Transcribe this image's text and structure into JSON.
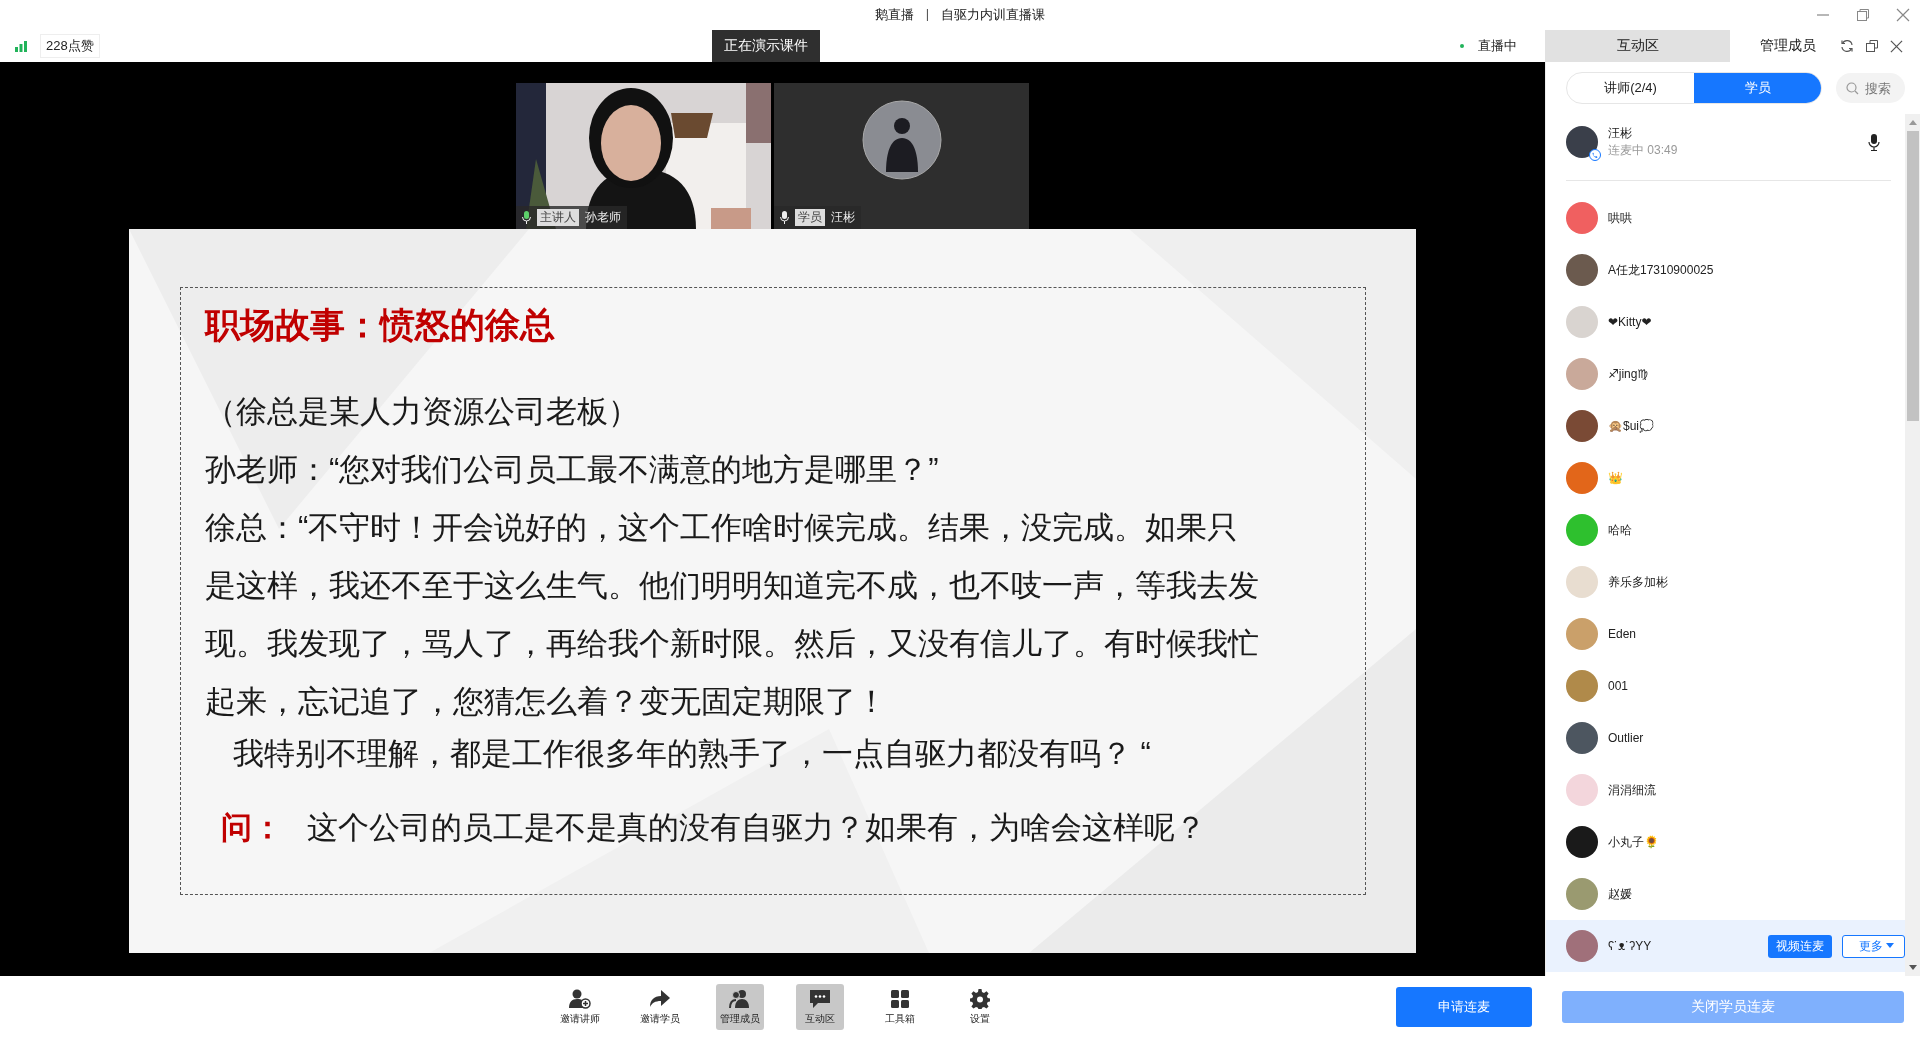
{
  "window": {
    "app": "鹅直播",
    "separator": "|",
    "title": "自驱力内训直播课"
  },
  "header": {
    "likes": "228点赞",
    "presenting": "正在演示课件",
    "live_status": "直播中",
    "tabs": [
      {
        "label": "互动区",
        "selected": true
      },
      {
        "label": "管理成员",
        "selected": false
      }
    ]
  },
  "videos": [
    {
      "kind": "picture",
      "role": "主讲人",
      "name": "孙老师"
    },
    {
      "kind": "avatar",
      "role": "学员",
      "name": "汪彬"
    }
  ],
  "slide": {
    "title": "职场故事：愤怒的徐总",
    "intro": "（徐总是某人力资源公司老板）",
    "question_line": "孙老师：“您对我们公司员工最不满意的地方是哪里？”",
    "answer_lines": [
      "徐总：“不守时！开会说好的，这个工作啥时候完成。结果，没完成。如果只",
      "是这样，我还不至于这么生气。他们明明知道完不成，也不吱一声，等我去发",
      "现。我发现了，骂人了，再给我个新时限。然后，又没有信儿了。有时候我忙",
      "起来，忘记追了，您猜怎么着？变无固定期限了！"
    ],
    "closing": "我特别不理解，都是工作很多年的熟手了，一点自驱力都没有吗？ “",
    "ask_label": "问：",
    "ask": "这个公司的员工是不是真的没有自驱力？如果有，为啥会这样呢？"
  },
  "panel": {
    "tabs": [
      {
        "label": "讲师(2/4)",
        "selected": false
      },
      {
        "label": "学员",
        "selected": true
      }
    ],
    "search": {
      "placeholder": "搜索"
    },
    "connected": {
      "name": "汪彬",
      "status": "连麦中 03:49",
      "color": "#3a3f4a"
    },
    "row_actions": [
      "视频连麦",
      "更多"
    ],
    "members": [
      {
        "name": "哄哄",
        "color": "#f06060",
        "selected": false
      },
      {
        "name": "A任龙17310900025",
        "color": "#6b5a4e",
        "selected": false
      },
      {
        "name": "❤Kitty❤",
        "color": "#d9d4d0",
        "selected": false
      },
      {
        "name": "♐jing♍",
        "color": "#c9a99a",
        "selected": false
      },
      {
        "name": "🙊$ui💭",
        "color": "#7a4a35",
        "selected": false
      },
      {
        "name": "👑",
        "color": "#e2661a",
        "selected": false
      },
      {
        "name": "哈哈",
        "color": "#2ec02e",
        "selected": false
      },
      {
        "name": "养乐多加彬",
        "color": "#e8ddd0",
        "selected": false
      },
      {
        "name": "Eden",
        "color": "#caa06a",
        "selected": false
      },
      {
        "name": "001",
        "color": "#b08a4a",
        "selected": false
      },
      {
        "name": "Outlier",
        "color": "#4d5660",
        "selected": false
      },
      {
        "name": "涓涓细流",
        "color": "#f3d6dc",
        "selected": false
      },
      {
        "name": "小丸子🌻",
        "color": "#1a1a1a",
        "selected": false
      },
      {
        "name": "赵媛",
        "color": "#9a9a70",
        "selected": false
      },
      {
        "name": "ʕ˙ᴥ˙ʔYY",
        "color": "#a0707a",
        "selected": true
      }
    ]
  },
  "toolbar": [
    {
      "kind": "invite-teacher",
      "label": "邀请讲师",
      "selected": false
    },
    {
      "kind": "invite-student",
      "label": "邀请学员",
      "selected": false
    },
    {
      "kind": "members",
      "label": "管理成员",
      "selected": true
    },
    {
      "kind": "chat",
      "label": "互动区",
      "selected": true
    },
    {
      "kind": "tools",
      "label": "工具箱",
      "selected": false
    },
    {
      "kind": "settings",
      "label": "设置",
      "selected": false
    }
  ],
  "buttons": {
    "request": "申请连麦",
    "close_all": "关闭学员连麦"
  }
}
